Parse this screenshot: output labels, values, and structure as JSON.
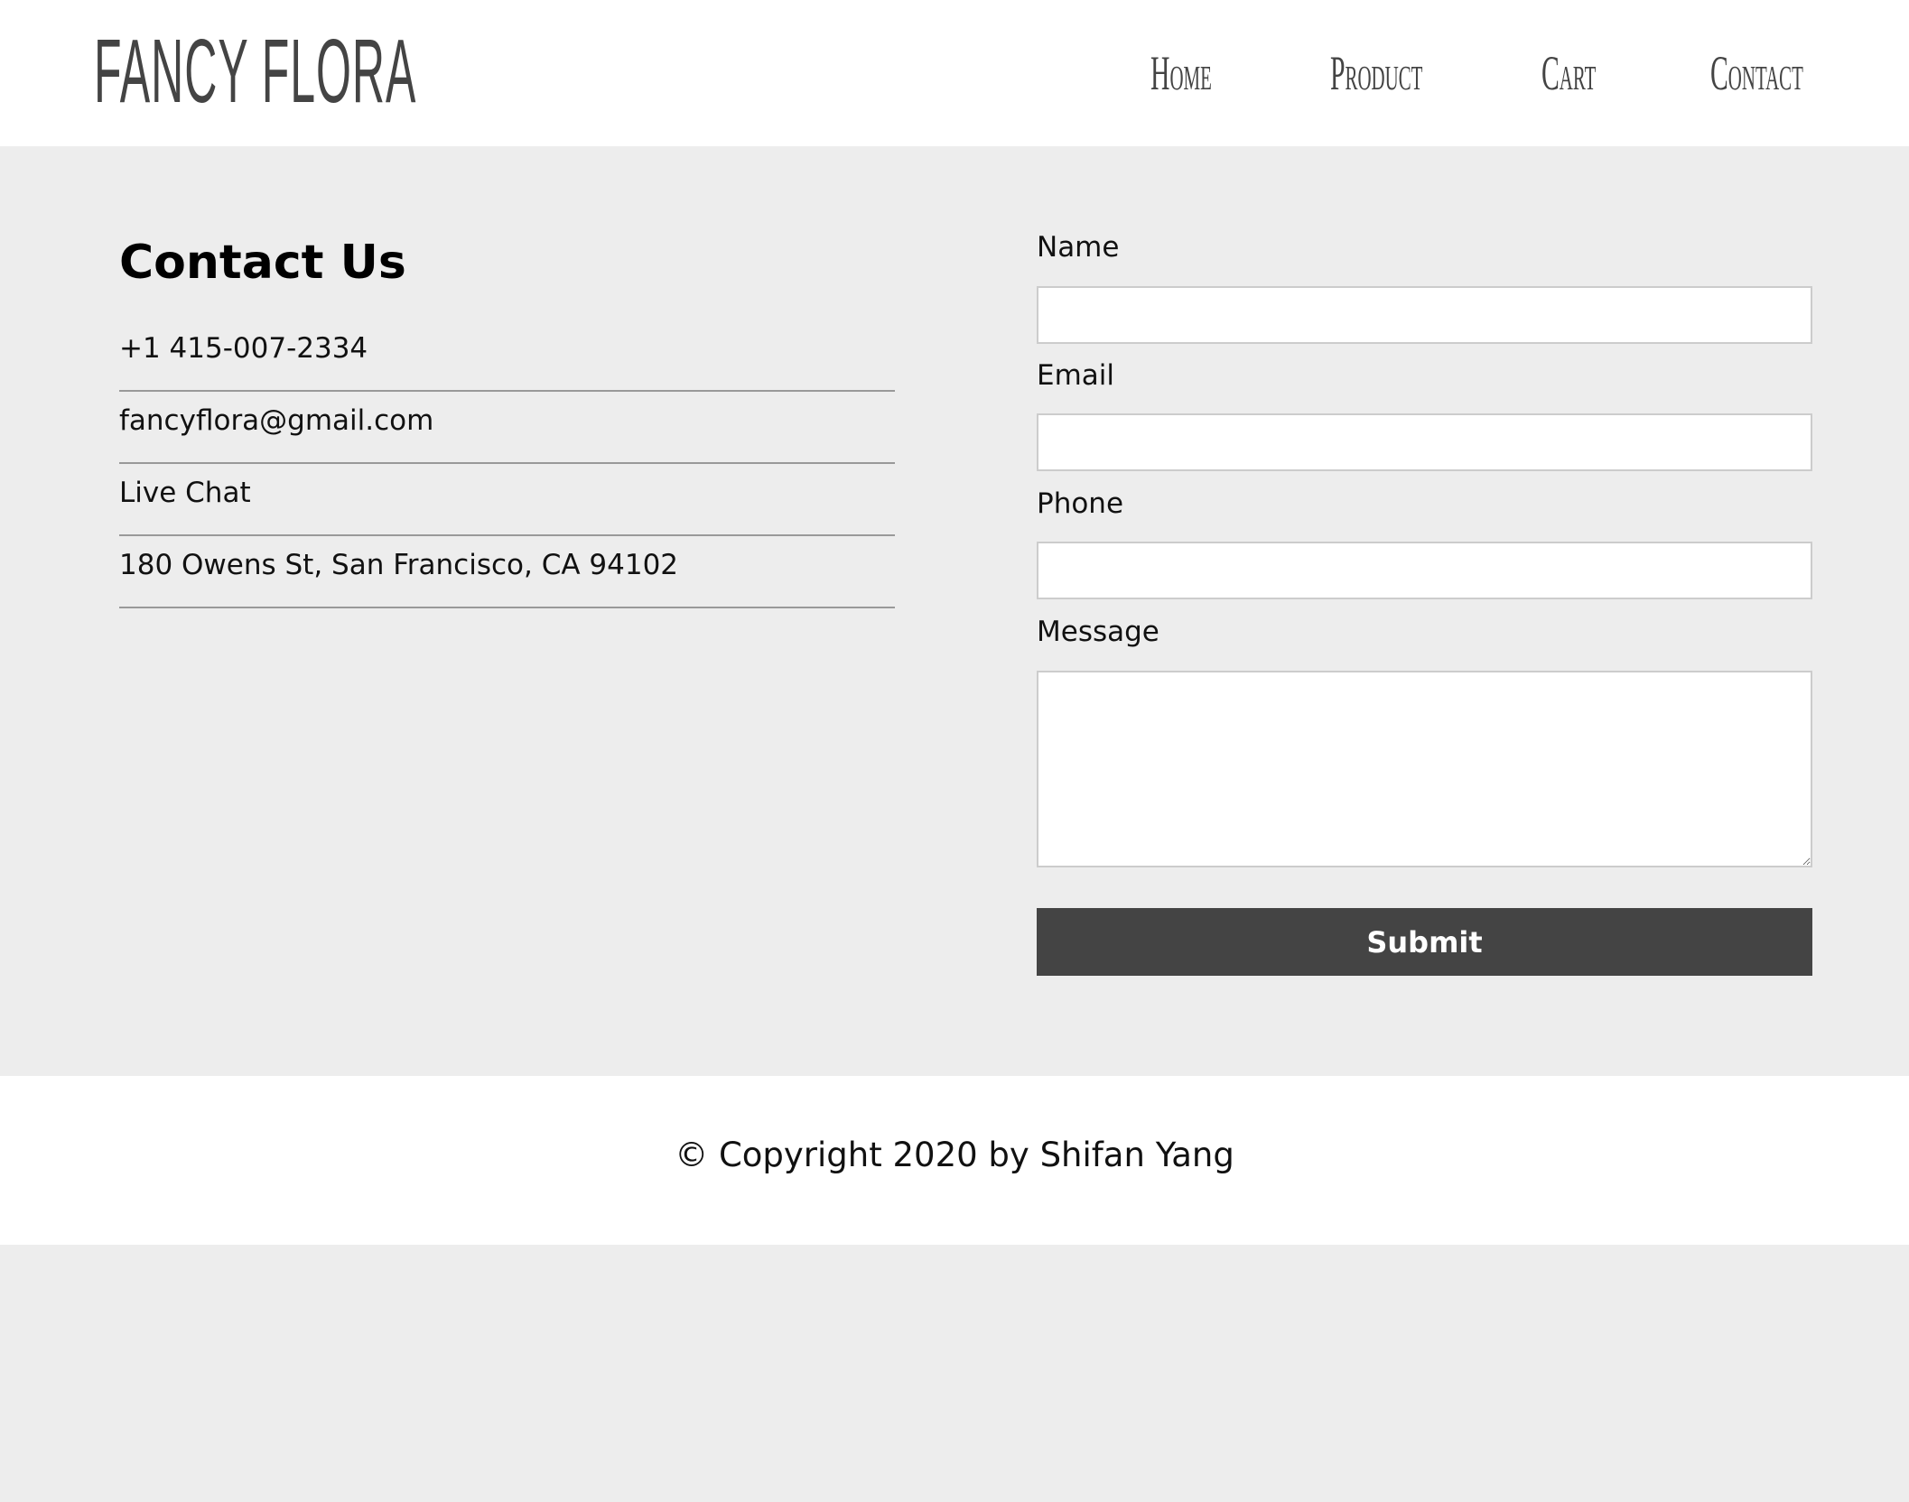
{
  "header": {
    "logo": "FANCY FLORA",
    "nav": [
      "Home",
      "Product",
      "Cart",
      "Contact"
    ]
  },
  "contact": {
    "title": "Contact Us",
    "items": [
      "+1 415-007-2334",
      "fancyflora@gmail.com",
      "Live Chat",
      "180 Owens St, San Francisco, CA 94102"
    ]
  },
  "form": {
    "name_label": "Name",
    "email_label": "Email",
    "phone_label": "Phone",
    "message_label": "Message",
    "name_value": "",
    "email_value": "",
    "phone_value": "",
    "message_value": "",
    "submit": "Submit"
  },
  "footer": {
    "copyright": "© Copyright 2020 by Shifan Yang"
  }
}
